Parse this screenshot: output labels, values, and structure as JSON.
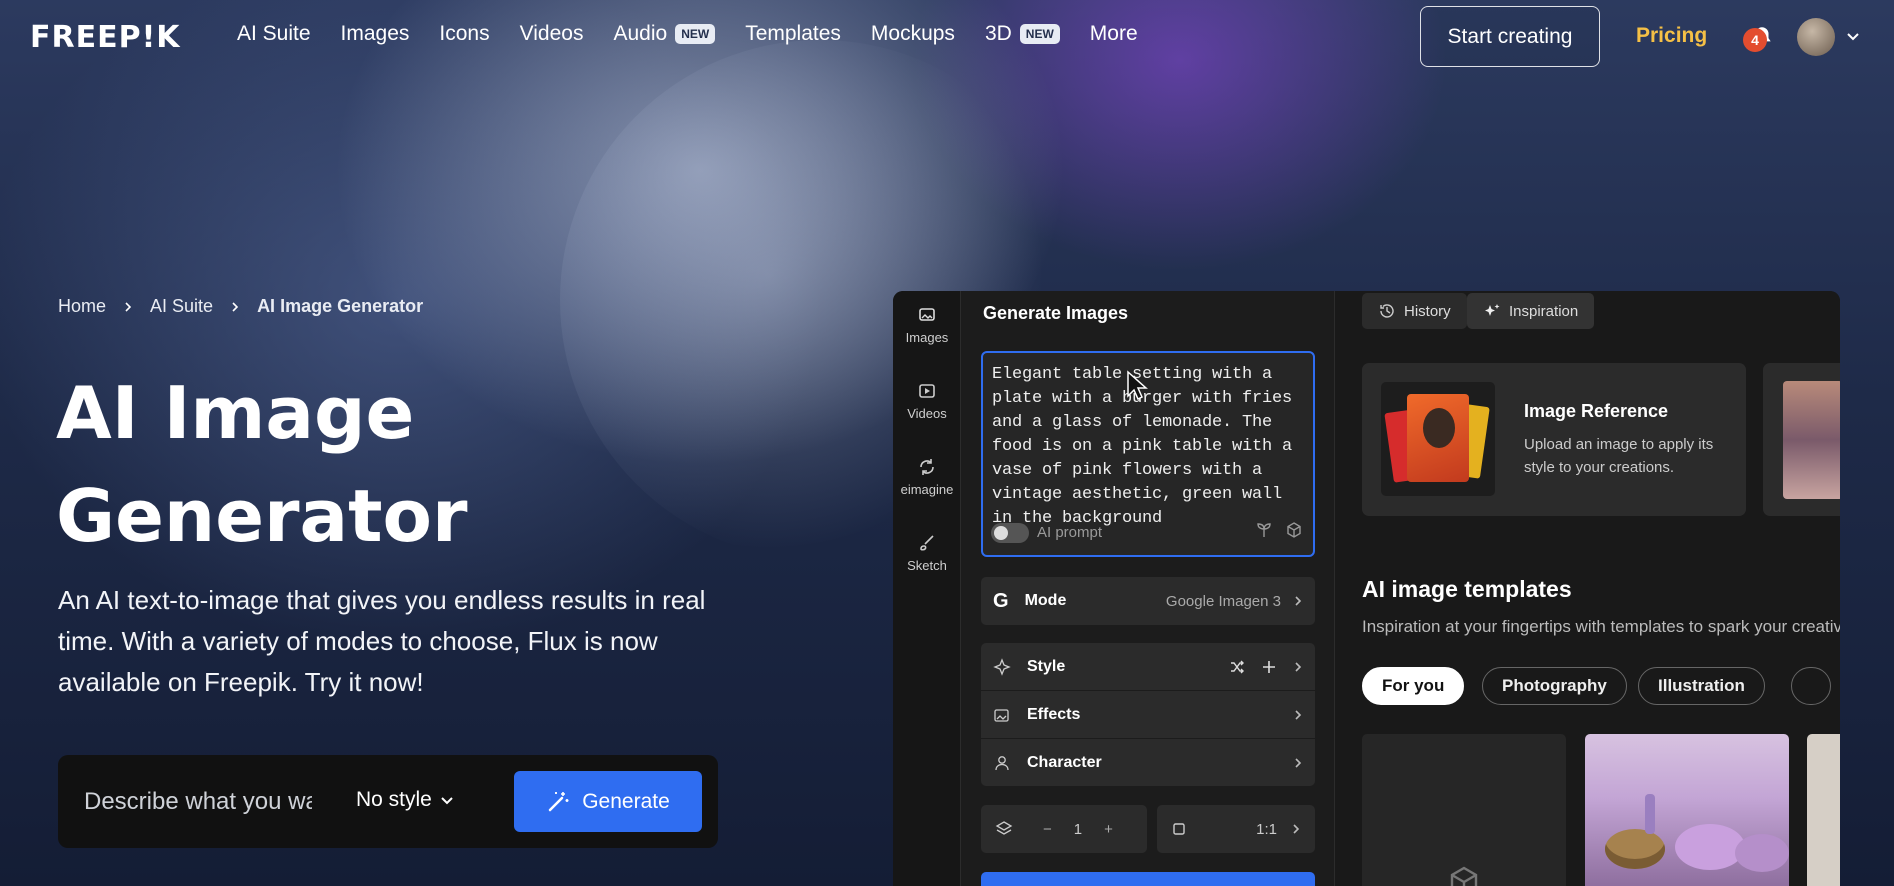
{
  "brand": {
    "logo_text": "FREEP!K"
  },
  "nav": {
    "items": [
      {
        "label": "AI Suite"
      },
      {
        "label": "Images"
      },
      {
        "label": "Icons"
      },
      {
        "label": "Videos"
      },
      {
        "label": "Audio",
        "badge": "NEW"
      },
      {
        "label": "Templates"
      },
      {
        "label": "Mockups"
      },
      {
        "label": "3D",
        "badge": "NEW"
      },
      {
        "label": "More"
      }
    ],
    "start_creating": "Start creating",
    "pricing": "Pricing",
    "notification_count": "4"
  },
  "breadcrumb": [
    "Home",
    "AI Suite",
    "AI Image Generator"
  ],
  "hero": {
    "title_line1": "AI Image",
    "title_line2": "Generator",
    "description": "An AI text-to-image that gives you endless results in real time. With a variety of modes to choose, Flux is now available on Freepik. Try it now!",
    "input_placeholder": "Describe what you want to generate",
    "style_value": "No style",
    "generate_label": "Generate"
  },
  "app": {
    "sidebar": [
      {
        "label": "Images",
        "icon": "images-icon"
      },
      {
        "label": "Videos",
        "icon": "video-icon"
      },
      {
        "label": "eimagine",
        "icon": "reimagine-icon"
      },
      {
        "label": "Sketch",
        "icon": "brush-icon"
      }
    ],
    "form_title": "Generate Images",
    "prompt_text": "Elegant table setting with a plate with a burger with fries and a glass of lemonade. The food is on a pink table with a vase of pink flowers with a vintage aesthetic, green wall in the background",
    "ai_prompt_label": "AI prompt",
    "mode_label": "Mode",
    "mode_value": "Google Imagen 3",
    "style_label": "Style",
    "effects_label": "Effects",
    "character_label": "Character",
    "image_count": "1",
    "aspect_ratio": "1:1",
    "tabs": {
      "history": "History",
      "inspiration": "Inspiration"
    },
    "reference": {
      "title": "Image Reference",
      "description": "Upload an image to apply its style to your creations."
    },
    "templates": {
      "title": "AI image templates",
      "description": "Inspiration at your fingertips with templates to spark your creativity",
      "chips": [
        "For you",
        "Photography",
        "Illustration"
      ]
    }
  },
  "colors": {
    "accent": "#2f6df1",
    "pricing": "#f5c046",
    "notification": "#e34d2f"
  }
}
